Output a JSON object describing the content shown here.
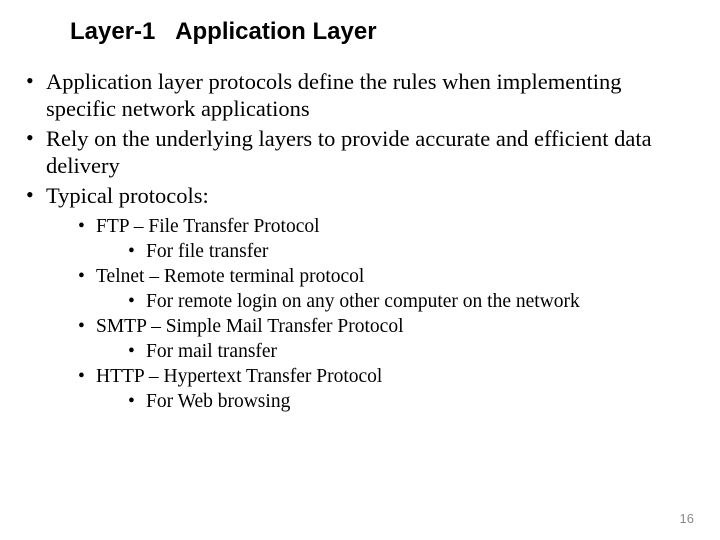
{
  "title_part1": "Layer-1",
  "title_part2": "Application Layer",
  "bullets": {
    "b1": "Application layer protocols define the rules when implementing specific network applications",
    "b2": "Rely on the underlying layers to provide accurate and efficient data delivery",
    "b3": "Typical protocols:"
  },
  "protocols": {
    "p1": {
      "name": "FTP – File Transfer Protocol",
      "desc": "For file transfer"
    },
    "p2": {
      "name": "Telnet – Remote terminal protocol",
      "desc": "For remote login on any other computer on the network"
    },
    "p3": {
      "name": "SMTP – Simple Mail Transfer Protocol",
      "desc": "For mail transfer"
    },
    "p4": {
      "name": "HTTP – Hypertext Transfer Protocol",
      "desc": "For Web browsing"
    }
  },
  "page_number": "16"
}
